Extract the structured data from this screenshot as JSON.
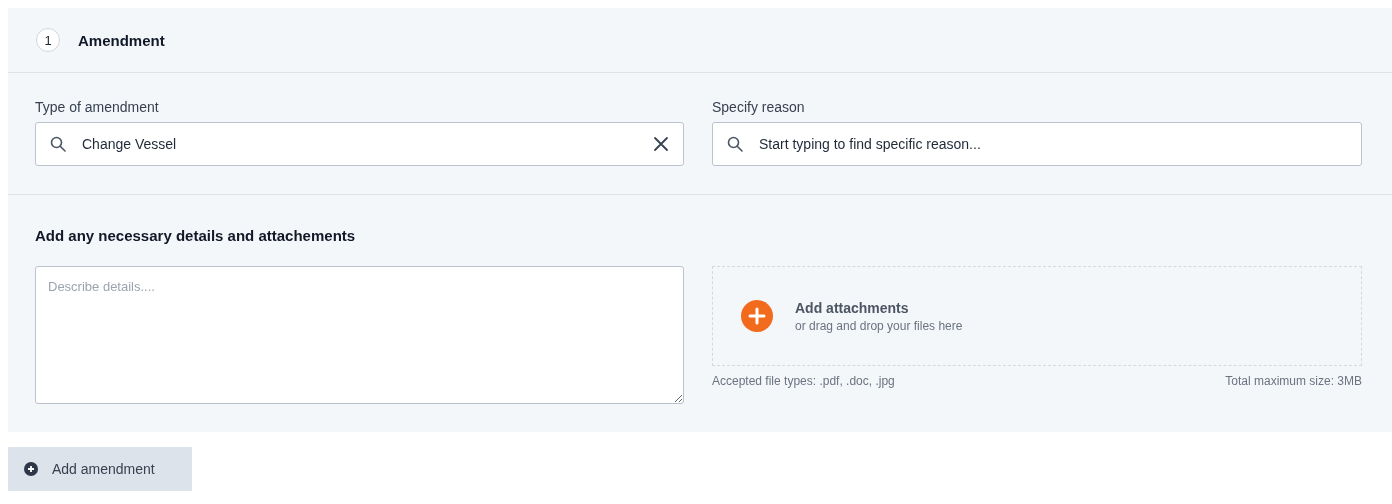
{
  "section": {
    "step": "1",
    "title": "Amendment"
  },
  "fields": [
    {
      "label": "Type of amendment",
      "value": "Change Vessel",
      "clearable": true
    },
    {
      "label": "Specify reason",
      "placeholder": "Start typing to find specific reason...",
      "clearable": false
    }
  ],
  "details": {
    "heading": "Add any necessary details and attachements",
    "placeholder": "Describe details....",
    "attach": {
      "title": "Add attachments",
      "subtitle": "or drag and drop your files here",
      "types": "Accepted file types: .pdf, .doc, .jpg",
      "max_size": "Total maximum size: 3MB"
    }
  },
  "add_button": "Add amendment"
}
